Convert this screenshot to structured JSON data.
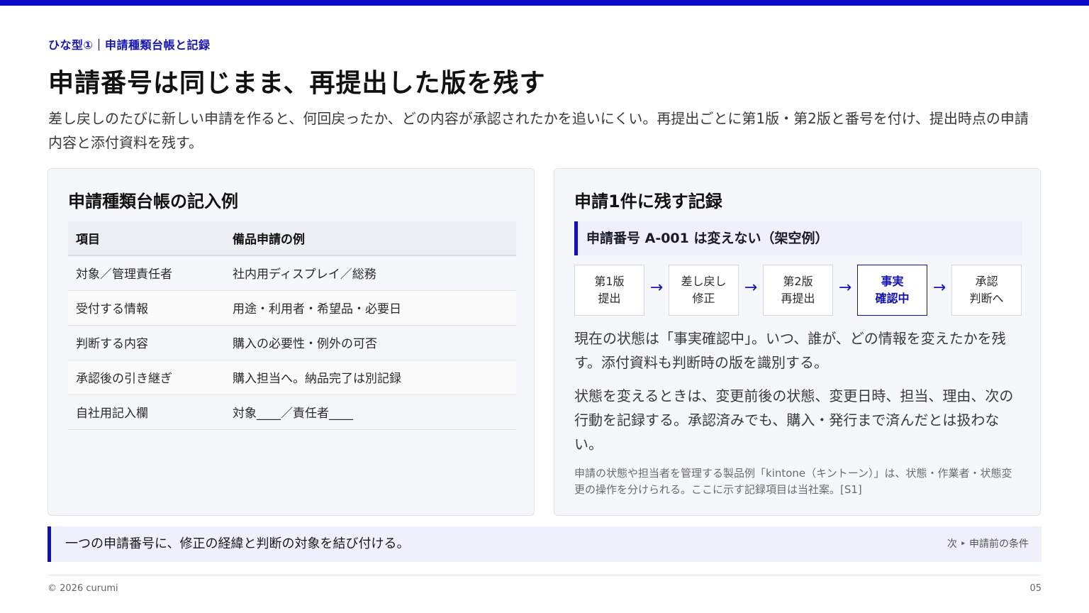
{
  "eyebrow": "ひな型①｜申請種類台帳と記録",
  "title": "申請番号は同じまま、再提出した版を残す",
  "lead": "差し戻しのたびに新しい申請を作ると、何回戻ったか、どの内容が承認されたかを追いにくい。再提出ごとに第1版・第2版と番号を付け、提出時点の申請内容と添付資料を残す。",
  "left_card": {
    "heading": "申請種類台帳の記入例",
    "columns": [
      "項目",
      "備品申請の例"
    ],
    "rows": [
      [
        "対象／管理責任者",
        "社内用ディスプレイ／総務"
      ],
      [
        "受付する情報",
        "用途・利用者・希望品・必要日"
      ],
      [
        "判断する内容",
        "購入の必要性・例外の可否"
      ],
      [
        "承認後の引き継ぎ",
        "購入担当へ。納品完了は別記録"
      ],
      [
        "自社用記入欄",
        "対象____／責任者____"
      ]
    ]
  },
  "right_card": {
    "heading": "申請1件に残す記録",
    "callout": "申請番号 A-001 は変えない（架空例）",
    "arrow": "→",
    "steps": [
      {
        "line1": "第1版",
        "line2": "提出"
      },
      {
        "line1": "差し戻し",
        "line2": "修正"
      },
      {
        "line1": "第2版",
        "line2": "再提出"
      },
      {
        "line1": "事実",
        "line2": "確認中"
      },
      {
        "line1": "承認",
        "line2": "判断へ"
      }
    ],
    "active_step": 3,
    "para1": "現在の状態は「事実確認中」。いつ、誰が、どの情報を変えたかを残す。添付資料も判断時の版を識別する。",
    "para2": "状態を変えるときは、変更前後の状態、変更日時、担当、理由、次の行動を記録する。承認済みでも、購入・発行まで済んだとは扱わない。",
    "note": "申請の状態や担当者を管理する製品例「kintone（キントーン）」は、状態・作業者・状態変更の操作を分けられる。ここに示す記録項目は当社案。[S1]"
  },
  "summary": {
    "text": "一つの申請番号に、修正の経緯と判断の対象を結び付ける。",
    "next": "次 ‣ 申請前の条件"
  },
  "footer": {
    "copyright": "© 2026 curumi",
    "page": "05"
  },
  "colors": {
    "accent": "#1010b4",
    "topbar": "#0a0ac8",
    "card_bg": "#f6f7fa",
    "callout_bg": "#eef0fb"
  }
}
